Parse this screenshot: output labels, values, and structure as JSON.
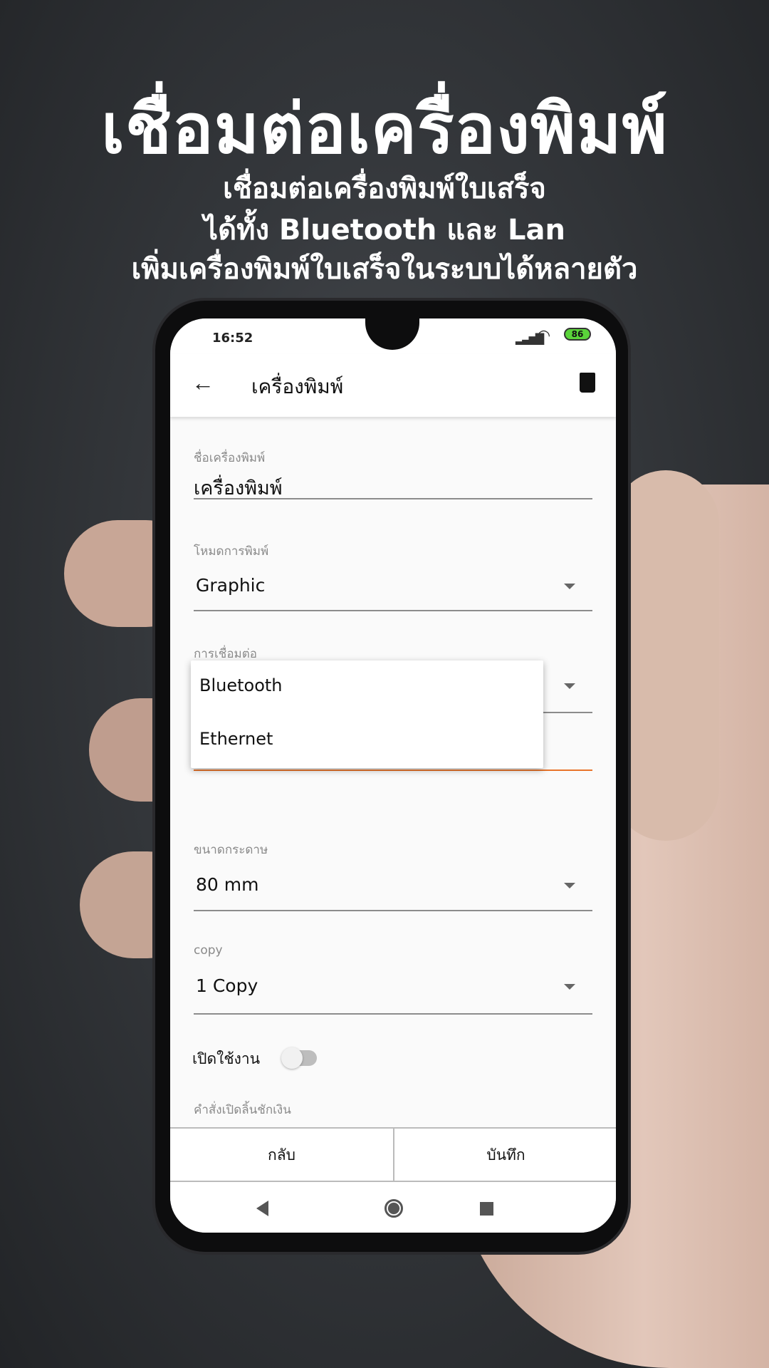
{
  "promo": {
    "title": "เชื่อมต่อเครื่องพิมพ์",
    "lines": [
      "เชื่อมต่อเครื่องพิมพ์ใบเสร็จ",
      "ได้ทั้ง Bluetooth และ Lan",
      "เพิ่มเครื่องพิมพ์ใบเสร็จในระบบได้หลายตัว"
    ]
  },
  "status": {
    "time": "16:52",
    "battery": "86",
    "battery_color": "#5ad43a"
  },
  "appbar": {
    "title": "เครื่องพิมพ์",
    "back_icon": "arrow-left-icon",
    "delete_icon": "trash-icon"
  },
  "form": {
    "printer_name": {
      "label": "ชื่อเครื่องพิมพ์",
      "value": "เครื่องพิมพ์"
    },
    "print_mode": {
      "label": "โหมดการพิมพ์",
      "value": "Graphic"
    },
    "connection": {
      "label": "การเชื่อมต่อ",
      "options": [
        "Bluetooth",
        "Ethernet"
      ]
    },
    "paper_size": {
      "label": "ขนาดกระดาษ",
      "value": "80 mm"
    },
    "copy": {
      "label": "copy",
      "value": "1 Copy"
    },
    "enabled": {
      "label": "เปิดใช้งาน",
      "on": false
    },
    "drawer_command": {
      "label": "คำสั่งเปิดลิ้นชักเงิน"
    }
  },
  "accent": "#e8742a",
  "buttons": {
    "back": "กลับ",
    "save": "บันทึก"
  }
}
